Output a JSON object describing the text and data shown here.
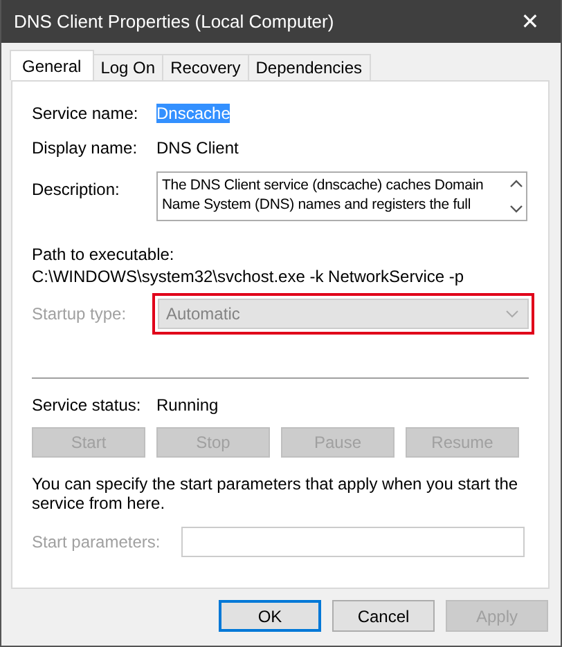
{
  "window": {
    "title": "DNS Client Properties (Local Computer)",
    "close": "✕"
  },
  "tabs": [
    {
      "label": "General",
      "selected": true
    },
    {
      "label": "Log On",
      "selected": false
    },
    {
      "label": "Recovery",
      "selected": false
    },
    {
      "label": "Dependencies",
      "selected": false
    }
  ],
  "service_name": {
    "label": "Service name:",
    "value": "Dnscache",
    "text_selected": true
  },
  "display_name": {
    "label": "Display name:",
    "value": "DNS Client"
  },
  "description": {
    "label": "Description:",
    "lines": [
      "The DNS Client service (dnscache) caches Domain",
      "Name System (DNS) names and registers the full"
    ]
  },
  "path": {
    "label": "Path to executable:",
    "value": "C:\\WINDOWS\\system32\\svchost.exe -k NetworkService -p"
  },
  "startup_type": {
    "label": "Startup type:",
    "value": "Automatic",
    "disabled": true,
    "highlighted": true
  },
  "service_status": {
    "label": "Service status:",
    "value": "Running"
  },
  "service_buttons": [
    {
      "label": "Start",
      "disabled": true
    },
    {
      "label": "Stop",
      "disabled": true
    },
    {
      "label": "Pause",
      "disabled": true
    },
    {
      "label": "Resume",
      "disabled": true
    }
  ],
  "hint": "You can specify the start parameters that apply when you start the service from here.",
  "start_parameters": {
    "label": "Start parameters:",
    "disabled": true
  },
  "dialog_buttons": [
    {
      "label": "OK",
      "disabled": false,
      "default": true
    },
    {
      "label": "Cancel",
      "disabled": false,
      "default": false
    },
    {
      "label": "Apply",
      "disabled": true,
      "default": false
    }
  ]
}
